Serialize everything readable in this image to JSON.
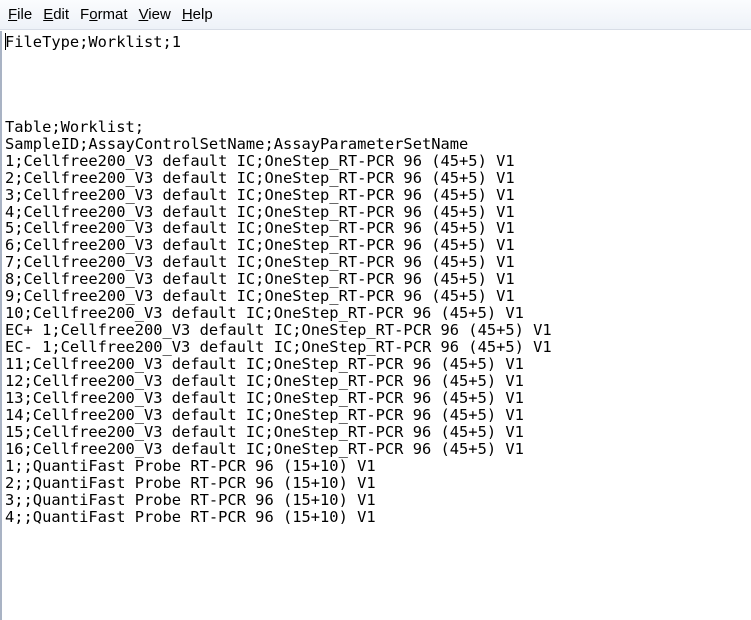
{
  "menu": {
    "items": [
      {
        "pre": "",
        "mnemonic": "F",
        "post": "ile"
      },
      {
        "pre": "",
        "mnemonic": "E",
        "post": "dit"
      },
      {
        "pre": "F",
        "mnemonic": "o",
        "post": "rmat"
      },
      {
        "pre": "",
        "mnemonic": "V",
        "post": "iew"
      },
      {
        "pre": "",
        "mnemonic": "H",
        "post": "elp"
      }
    ]
  },
  "document": {
    "lines": [
      "FileType;Worklist;1",
      "",
      "",
      "",
      "",
      "Table;Worklist;",
      "SampleID;AssayControlSetName;AssayParameterSetName",
      "1;Cellfree200_V3 default IC;OneStep_RT-PCR 96 (45+5) V1",
      "2;Cellfree200_V3 default IC;OneStep_RT-PCR 96 (45+5) V1",
      "3;Cellfree200_V3 default IC;OneStep_RT-PCR 96 (45+5) V1",
      "4;Cellfree200_V3 default IC;OneStep_RT-PCR 96 (45+5) V1",
      "5;Cellfree200_V3 default IC;OneStep_RT-PCR 96 (45+5) V1",
      "6;Cellfree200_V3 default IC;OneStep_RT-PCR 96 (45+5) V1",
      "7;Cellfree200_V3 default IC;OneStep_RT-PCR 96 (45+5) V1",
      "8;Cellfree200_V3 default IC;OneStep_RT-PCR 96 (45+5) V1",
      "9;Cellfree200_V3 default IC;OneStep_RT-PCR 96 (45+5) V1",
      "10;Cellfree200_V3 default IC;OneStep_RT-PCR 96 (45+5) V1",
      "EC+ 1;Cellfree200_V3 default IC;OneStep_RT-PCR 96 (45+5) V1",
      "EC- 1;Cellfree200_V3 default IC;OneStep_RT-PCR 96 (45+5) V1",
      "11;Cellfree200_V3 default IC;OneStep_RT-PCR 96 (45+5) V1",
      "12;Cellfree200_V3 default IC;OneStep_RT-PCR 96 (45+5) V1",
      "13;Cellfree200_V3 default IC;OneStep_RT-PCR 96 (45+5) V1",
      "14;Cellfree200_V3 default IC;OneStep_RT-PCR 96 (45+5) V1",
      "15;Cellfree200_V3 default IC;OneStep_RT-PCR 96 (45+5) V1",
      "16;Cellfree200_V3 default IC;OneStep_RT-PCR 96 (45+5) V1",
      "1;;QuantiFast Probe RT-PCR 96 (15+10) V1",
      "2;;QuantiFast Probe RT-PCR 96 (15+10) V1",
      "3;;QuantiFast Probe RT-PCR 96 (15+10) V1",
      "4;;QuantiFast Probe RT-PCR 96 (15+10) V1"
    ]
  }
}
